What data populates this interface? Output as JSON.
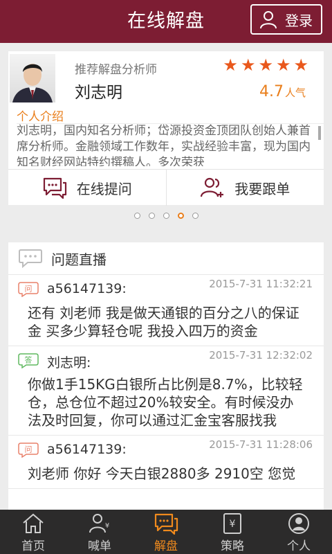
{
  "header": {
    "title": "在线解盘",
    "login_label": "登录"
  },
  "analyst": {
    "subtitle": "推荐解盘分析师",
    "name": "刘志明",
    "rating_stars": 5,
    "popularity_value": "4.7",
    "popularity_unit": "人气",
    "intro_heading": "个人介绍",
    "intro_text": "刘志明，国内知名分析师；岱源投资金顶团队创始人兼首席分析师。金融领域工作数年，实战经验丰富，现为国内知名财经网站特约撰稿人。多次荣获",
    "actions": {
      "ask": "在线提问",
      "follow": "我要跟单"
    }
  },
  "pager": {
    "count": 5,
    "active_index": 3
  },
  "qa": {
    "title": "问题直播",
    "entries": [
      {
        "type": "问",
        "user": "a56147139:",
        "time": "2015-7-31 11:32:21",
        "text": "还有 刘老师 我是做天通银的百分之八的保证金  买多少算轻仓呢 我投入四万的资金"
      },
      {
        "type": "答",
        "user": "刘志明:",
        "time": "2015-7-31 12:32:02",
        "text": "你做1手15KG白银所占比例是8.7%，比较轻仓，总仓位不超过20%较安全。有时候没办法及时回复，你可以通过汇金宝客服找我"
      },
      {
        "type": "问",
        "user": "a56147139:",
        "time": "2015-7-31 11:28:06",
        "text": "刘老师 你好 今天白银2880多 2910空 您觉"
      }
    ]
  },
  "tabs": [
    {
      "label": "首页",
      "icon": "home-icon"
    },
    {
      "label": "喊单",
      "icon": "call-order-icon"
    },
    {
      "label": "解盘",
      "icon": "chat-icon"
    },
    {
      "label": "策略",
      "icon": "strategy-icon"
    },
    {
      "label": "个人",
      "icon": "person-icon"
    }
  ],
  "colors": {
    "brand": "#7d1d33",
    "accent": "#e97e1b",
    "star": "#e9581c",
    "tabbar": "#2c2b2b"
  }
}
